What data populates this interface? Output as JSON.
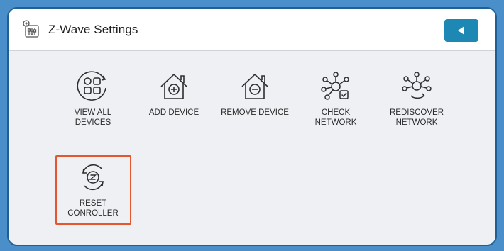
{
  "header": {
    "title": "Z-Wave Settings",
    "app_icon": "settings-sliders-icon",
    "back_icon": "triangle-left-icon",
    "back_button_color": "#1e88b5"
  },
  "tiles": [
    {
      "label": "VIEW ALL\nDEVICES",
      "icon": "grid-devices-icon"
    },
    {
      "label": "ADD DEVICE",
      "icon": "house-plus-icon"
    },
    {
      "label": "REMOVE DEVICE",
      "icon": "house-minus-icon"
    },
    {
      "label": "CHECK\nNETWORK",
      "icon": "network-check-icon"
    },
    {
      "label": "REDISCOVER\nNETWORK",
      "icon": "network-refresh-icon"
    },
    {
      "label": "RESET\nCONROLLER",
      "icon": "reset-controller-icon"
    }
  ],
  "colors": {
    "background": "#4a8fc9",
    "panel": "#eef0f3",
    "highlight": "#e4572e",
    "icon_stroke": "#2e2e2e"
  }
}
